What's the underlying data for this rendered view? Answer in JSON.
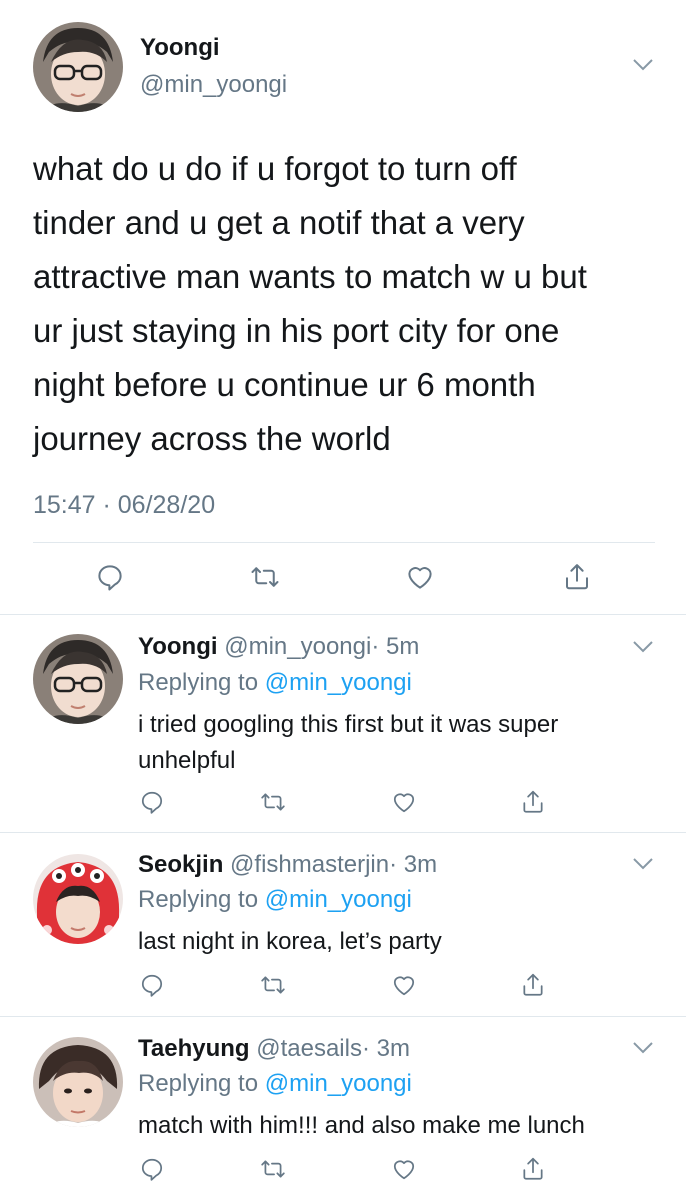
{
  "main_tweet": {
    "name": "Yoongi",
    "handle": "@min_yoongi",
    "text_lines": [
      "what do u do if u forgot to turn off",
      "tinder and u get a notif that a very",
      "attractive man wants to match w u but",
      "ur just staying in his port city for one",
      "night before u continue ur 6 month",
      "journey across the world"
    ],
    "timestamp": "15:47 · 06/28/20"
  },
  "replies": [
    {
      "name": "Yoongi",
      "handle": "@min_yoongi",
      "time": "· 5m",
      "replying_label": "Replying to",
      "replying_handle": "@min_yoongi",
      "text_lines": [
        "i tried googling this first but it was super",
        "unhelpful"
      ]
    },
    {
      "name": "Seokjin",
      "handle": "@fishmasterjin",
      "time": "· 3m",
      "replying_label": "Replying to",
      "replying_handle": "@min_yoongi",
      "text_lines": [
        "last night in korea, let’s party"
      ]
    },
    {
      "name": "Taehyung",
      "handle": "@taesails",
      "time": "· 3m",
      "replying_label": "Replying to",
      "replying_handle": "@min_yoongi",
      "text_lines": [
        "match with him!!! and also make me lunch"
      ]
    }
  ],
  "icons": [
    "reply-icon",
    "retweet-icon",
    "like-icon",
    "share-icon",
    "chevron-down-icon"
  ],
  "colors": {
    "text": "#14171a",
    "secondary": "#657786",
    "link": "#1da1f2",
    "divider": "#e1e8ed"
  }
}
